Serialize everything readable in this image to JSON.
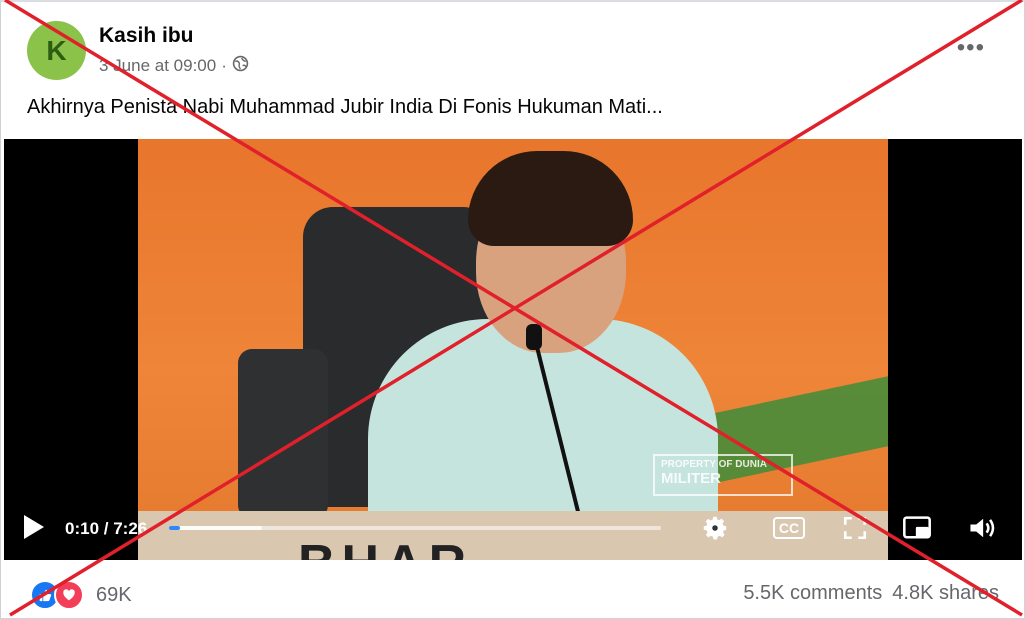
{
  "post": {
    "author": "Kasih ibu",
    "avatar_initial": "K",
    "timestamp": "3 June at 09:00",
    "separator": "·",
    "privacy_icon": "globe-icon",
    "more_label": "•••",
    "caption": "Akhirnya Penista Nabi Muhammad Jubir India Di Fonis Hukuman Mati..."
  },
  "video": {
    "desk_text": "BHAR",
    "watermark_line1": "PROPERTY OF DUNIA",
    "watermark_line2": "MILITER",
    "current_time": "0:10",
    "duration": "7:26",
    "progress_fraction": 0.022,
    "buffered_fraction": 0.19,
    "icons": [
      "play-icon",
      "settings-gear-icon",
      "closed-captions-icon",
      "fullscreen-icon",
      "picture-in-picture-icon",
      "volume-icon"
    ],
    "cc_label": "CC"
  },
  "engagement": {
    "reaction_count": "69K",
    "comments": "5.5K comments",
    "shares": "4.8K shares",
    "reaction_icons": [
      "like-icon",
      "love-icon"
    ]
  },
  "colors": {
    "cross": "#e0202a",
    "accent": "#1877f2",
    "love": "#f33e58",
    "muted_text": "#65676b"
  }
}
